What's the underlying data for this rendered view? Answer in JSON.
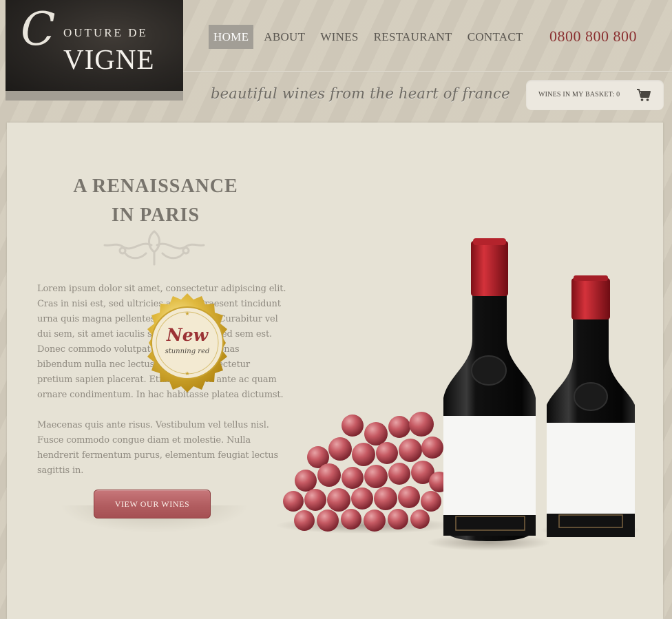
{
  "logo": {
    "initial": "C",
    "top_text": "OUTURE DE",
    "main_text": "VIGNE"
  },
  "nav": {
    "items": [
      {
        "label": "HOME",
        "active": true
      },
      {
        "label": "ABOUT",
        "active": false
      },
      {
        "label": "WINES",
        "active": false
      },
      {
        "label": "RESTAURANT",
        "active": false
      },
      {
        "label": "CONTACT",
        "active": false
      }
    ]
  },
  "phone": "0800 800 800",
  "tagline": "beautiful wines from the heart of france",
  "basket": {
    "label": "WINES IN MY BASKET: 0",
    "icon": "cart-icon"
  },
  "main": {
    "heading_line1": "A RENAISSANCE",
    "heading_line2": "IN PARIS",
    "paragraph1": "Lorem ipsum dolor sit amet, consectetur adipiscing elit. Cras in nisi est, sed ultricies augue. Praesent tincidunt urna quis magna pellentesque convallis. Curabitur vel dui sem, sit amet iaculis sem. Curabitur sed sem est. Donec commodo volutpat aliquam. Maecenas bibendum nulla nec lectus tristique consectetur pretium sapien placerat. Etiam eleifend ante ac quam ornare condimentum. In hac habitasse platea dictumst.",
    "paragraph2": "Maecenas quis ante risus. Vestibulum vel tellus nisl. Fusce commodo congue diam et molestie. Nulla hendrerit fermentum purus, elementum feugiat lectus sagittis in.",
    "button_label": "VIEW OUR WINES",
    "badge_title": "New",
    "badge_subtitle": "stunning red"
  },
  "colors": {
    "accent_red": "#8a2f30",
    "button_red": "#b25d60",
    "panel_bg": "#e6e2d5",
    "page_bg": "#d3ccbc",
    "logo_bg": "#2a2724"
  }
}
